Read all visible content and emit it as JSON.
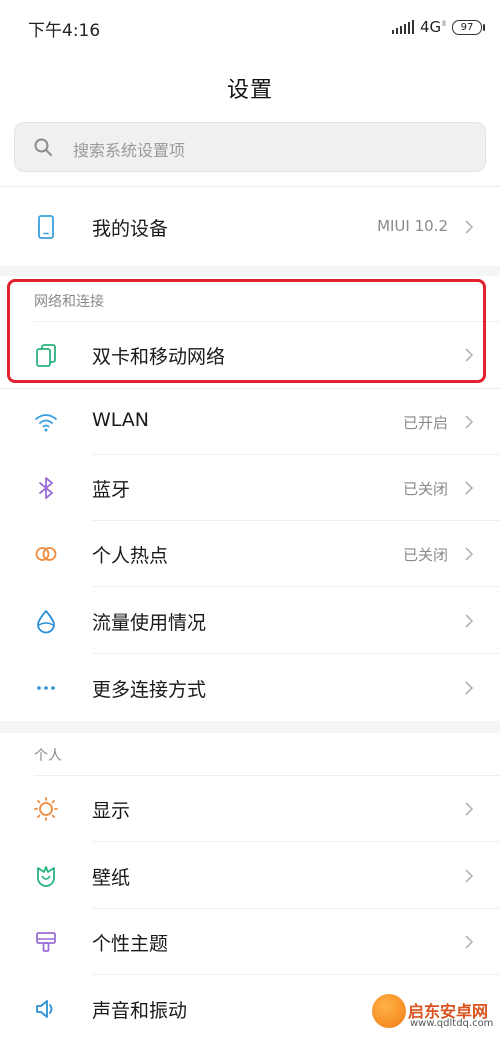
{
  "status_bar": {
    "time": "下午4:16",
    "network": "4G",
    "network_sub": "ll",
    "battery": "97"
  },
  "header": {
    "title": "设置"
  },
  "search": {
    "placeholder": "搜索系统设置项"
  },
  "top_items": [
    {
      "label": "我的设备",
      "value": "MIUI 10.2",
      "icon": "phone-icon",
      "color": "#3aa0dc"
    }
  ],
  "section_network": {
    "header": "网络和连接",
    "items": [
      {
        "label": "双卡和移动网络",
        "value": "",
        "icon": "sim-cards-icon",
        "color": "#2bb37f"
      },
      {
        "label": "WLAN",
        "value": "已开启",
        "icon": "wifi-icon",
        "color": "#3aa0dc"
      },
      {
        "label": "蓝牙",
        "value": "已关闭",
        "icon": "bluetooth-icon",
        "color": "#9b6fd6"
      },
      {
        "label": "个人热点",
        "value": "已关闭",
        "icon": "hotspot-icon",
        "color": "#f08a3c"
      },
      {
        "label": "流量使用情况",
        "value": "",
        "icon": "data-usage-icon",
        "color": "#2a8fd6"
      },
      {
        "label": "更多连接方式",
        "value": "",
        "icon": "more-dots-icon",
        "color": "#2a8fd6"
      }
    ]
  },
  "section_personal": {
    "header": "个人",
    "items": [
      {
        "label": "显示",
        "value": "",
        "icon": "display-sun-icon",
        "color": "#f08a3c"
      },
      {
        "label": "壁纸",
        "value": "",
        "icon": "wallpaper-icon",
        "color": "#2bb37f"
      },
      {
        "label": "个性主题",
        "value": "",
        "icon": "theme-brush-icon",
        "color": "#9b6fd6"
      },
      {
        "label": "声音和振动",
        "value": "",
        "icon": "speaker-icon",
        "color": "#2a8fd6"
      }
    ]
  },
  "watermark": {
    "title": "启东安卓网",
    "url": "www.qdltdq.com"
  }
}
